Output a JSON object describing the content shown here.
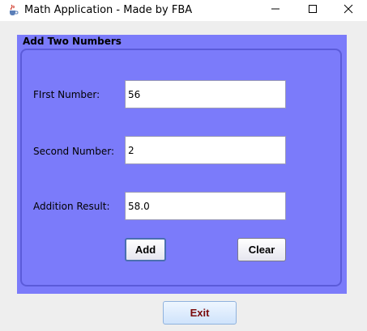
{
  "window": {
    "title": "Math Application - Made by FBA",
    "controls": [
      "minimize",
      "maximize",
      "close"
    ]
  },
  "panel": {
    "title": "Add Two Numbers",
    "background": "#7b7bfa"
  },
  "form": {
    "first_label": "FIrst Number:",
    "first_value": "56",
    "second_label": "Second Number:",
    "second_value": "2",
    "result_label": "Addition Result:",
    "result_value": "58.0"
  },
  "buttons": {
    "add_label": "Add",
    "clear_label": "Clear",
    "exit_label": "Exit"
  },
  "icons": {
    "app": "java-cup-icon",
    "minimize": "minimize-icon",
    "maximize": "maximize-icon",
    "close": "close-icon"
  }
}
